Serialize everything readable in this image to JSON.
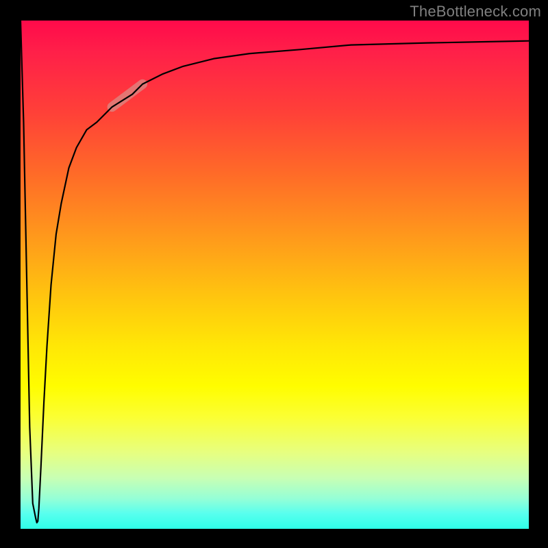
{
  "attribution": "TheBottleneck.com",
  "chart_data": {
    "type": "line",
    "title": "",
    "xlabel": "",
    "ylabel": "",
    "xlim": [
      0,
      100
    ],
    "ylim": [
      0,
      100
    ],
    "grid": false,
    "legend": false,
    "background_gradient": {
      "direction": "top-to-bottom",
      "stops": [
        {
          "pos": 0.0,
          "color": "#ff0a4a"
        },
        {
          "pos": 0.18,
          "color": "#ff4038"
        },
        {
          "pos": 0.42,
          "color": "#ff971c"
        },
        {
          "pos": 0.64,
          "color": "#ffe706"
        },
        {
          "pos": 0.78,
          "color": "#fbff33"
        },
        {
          "pos": 0.9,
          "color": "#c8ffb4"
        },
        {
          "pos": 1.0,
          "color": "#2effe8"
        }
      ]
    },
    "series": [
      {
        "name": "main-curve",
        "color": "#000000",
        "width": 2.2,
        "x": [
          0.0,
          0.6,
          1.2,
          1.8,
          2.4,
          3.0,
          3.2,
          3.4,
          3.6,
          4.0,
          4.6,
          5.2,
          6.0,
          7.0,
          8.0,
          9.5,
          11.0,
          13.0,
          15.0,
          18.0,
          22.0,
          24.0,
          28.0,
          32.0,
          38.0,
          45.0,
          55.0,
          65.0,
          80.0,
          100.0
        ],
        "y": [
          100.0,
          80.0,
          50.0,
          20.0,
          5.0,
          2.0,
          1.2,
          1.5,
          4.0,
          12.0,
          25.0,
          36.0,
          48.0,
          58.0,
          64.0,
          71.0,
          75.0,
          78.5,
          80.0,
          83.0,
          85.5,
          87.5,
          89.5,
          91.0,
          92.5,
          93.5,
          94.3,
          95.2,
          95.6,
          96.0
        ]
      },
      {
        "name": "highlight-segment",
        "color": "#d98b86",
        "opacity": 0.75,
        "width": 14,
        "linecap": "round",
        "x": [
          18.0,
          24.0
        ],
        "y": [
          83.0,
          87.5
        ]
      }
    ]
  }
}
